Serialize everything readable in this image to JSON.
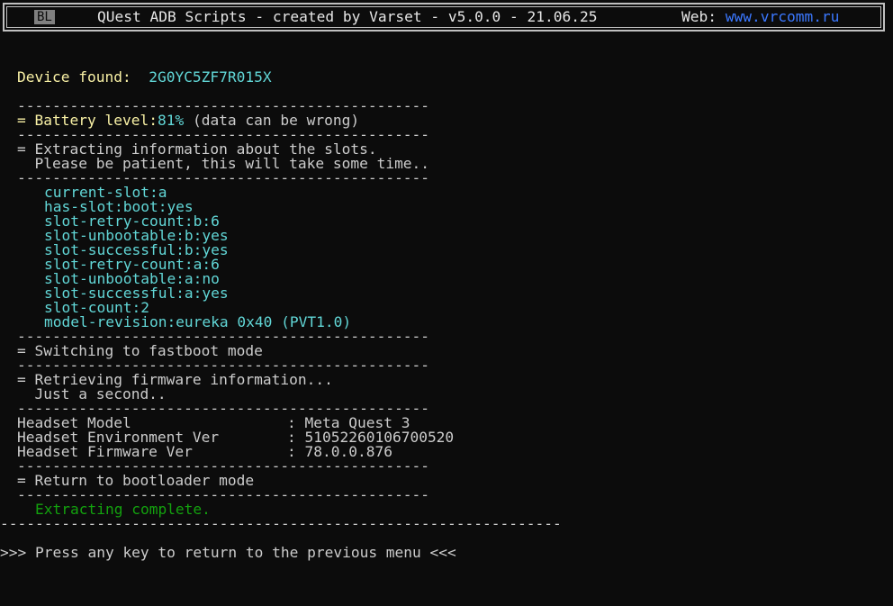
{
  "header": {
    "badge": "BL",
    "title": "QUest ADB Scripts - created by Varset - v5.0.0 - 21.06.25",
    "web_label": "Web: ",
    "web_link": "www.vrcomm.ru"
  },
  "device": {
    "label": "Device found:",
    "id": "2G0YC5ZF7R015X"
  },
  "separator": "-----------------------------------------------",
  "battery": {
    "prefix": "= ",
    "label": "Battery level:",
    "value": "81%",
    "note": " (data can be wrong)"
  },
  "slots_section": {
    "line1": "= Extracting information about the slots.",
    "line2": "  Please be patient, this will take some time.."
  },
  "slot_info": [
    "current-slot:a",
    "has-slot:boot:yes",
    "slot-retry-count:b:6",
    "slot-unbootable:b:yes",
    "slot-successful:b:yes",
    "slot-retry-count:a:6",
    "slot-unbootable:a:no",
    "slot-successful:a:yes",
    "slot-count:2",
    "model-revision:eureka 0x40 (PVT1.0)"
  ],
  "fastboot": "= Switching to fastboot mode",
  "firmware_section": {
    "line1": "= Retrieving firmware information...",
    "line2": "  Just a second.."
  },
  "headset": [
    {
      "key": "Headset Model",
      "value": "Meta Quest 3"
    },
    {
      "key": "Headset Environment Ver",
      "value": "51052260106700520"
    },
    {
      "key": "Headset Firmware Ver",
      "value": "78.0.0.876"
    }
  ],
  "bootloader": "= Return to bootloader mode",
  "complete": "Extracting complete.",
  "long_separator": "----------------------------------------------------------------",
  "prompt": ">>> Press any key to return to the previous menu <<<"
}
